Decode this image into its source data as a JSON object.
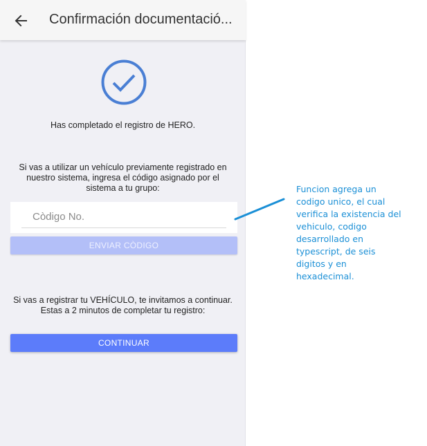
{
  "appbar": {
    "back_icon": "arrow-left-icon",
    "title": "Confirmación documentació..."
  },
  "status": {
    "icon": "check-circle-icon",
    "accent_color": "#4a7fd4",
    "message": "Has completado el registro de HERO."
  },
  "code_section": {
    "instructions_line1": "Si vas a utilizar un vehículo previamente registrado en",
    "instructions_line2": "nuestro sistema, ingresa el código asignado por el",
    "instructions_line3": "sistema a tu grupo:",
    "input_placeholder": "Còdigo No.",
    "input_value": "",
    "send_button_label": "ENVIAR CÒDIGO",
    "send_button_state": "disabled"
  },
  "continue_section": {
    "text_line1": "Si vas a registrar tu VEHÍCULO, te invitamos a continuar.",
    "text_line2": "Estas a 2 minutos de completar tu registro:",
    "continue_button_label": "CONTINUAR"
  },
  "annotation": {
    "color": "#1a8fd6",
    "lines": [
      "Funcion agrega un",
      "codigo unico, el cual",
      "verifica la existencia del",
      "vehiculo, codigo",
      "desarrollado en",
      "typescript, de seis",
      "digitos y en",
      "hexadecimal."
    ]
  }
}
